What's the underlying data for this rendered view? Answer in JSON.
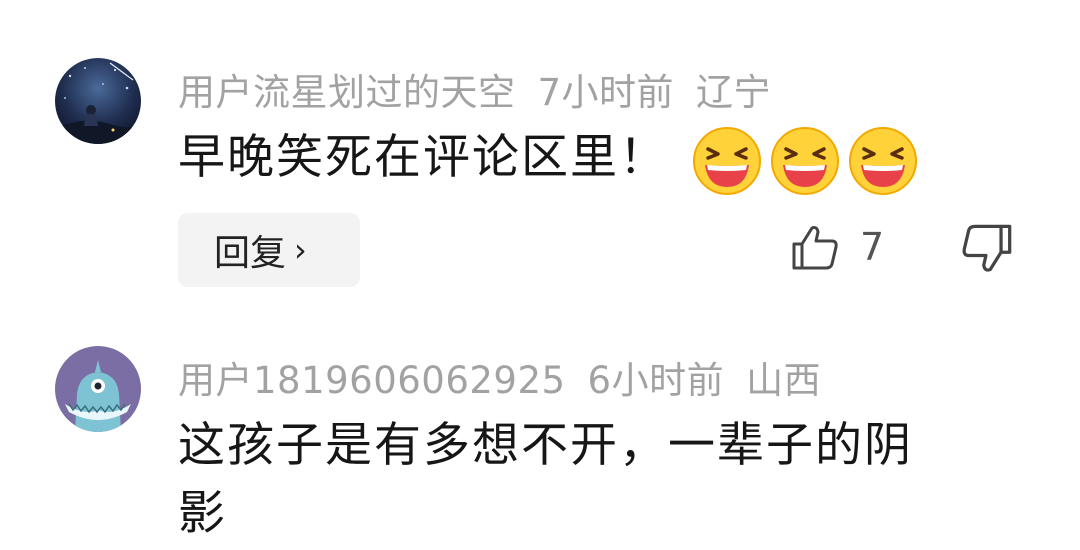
{
  "comments": [
    {
      "username": "用户流星划过的天空",
      "time": "7小时前",
      "location": "辽宁",
      "text": "早晚笑死在评论区里！",
      "emojis": [
        "laughing-emoji",
        "laughing-emoji",
        "laughing-emoji"
      ],
      "avatar": "starry-sky-avatar",
      "reply_label": "回复",
      "reply_chevron": "›",
      "like_count": "7"
    },
    {
      "username": "用户1819606062925",
      "time": "6小时前",
      "location": "山西",
      "text_line1": "这孩子是有多想不开，一辈子的阴",
      "text_line2": "影",
      "avatar": "cartoon-monster-avatar"
    }
  ],
  "colors": {
    "meta_text": "#a2a2a2",
    "body_text": "#161616",
    "reply_bg": "#f3f3f3",
    "avatar2_bg": "#7b6ea5",
    "emoji_yellow": "#ffd23a"
  }
}
